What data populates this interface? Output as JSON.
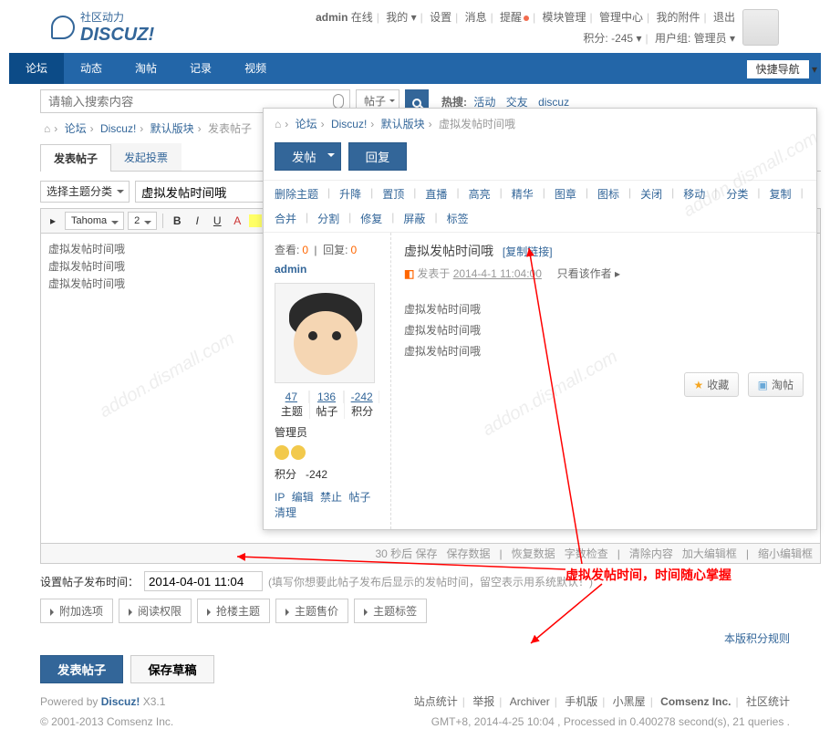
{
  "header": {
    "logo_cn": "社区动力",
    "logo_en": "DISCUZ!",
    "user": "admin",
    "status": "在线",
    "menu": [
      "我的",
      "设置",
      "消息",
      "提醒",
      "模块管理",
      "管理中心",
      "我的附件",
      "退出"
    ],
    "credits_label": "积分:",
    "credits": "-245",
    "group_label": "用户组:",
    "group": "管理员"
  },
  "nav": {
    "items": [
      "论坛",
      "动态",
      "淘帖",
      "记录",
      "视频"
    ],
    "quick": "快捷导航"
  },
  "search": {
    "placeholder": "请输入搜索内容",
    "scope": "帖子",
    "hot_label": "热搜:",
    "hot": [
      "活动",
      "交友",
      "discuz"
    ]
  },
  "bc": [
    "论坛",
    "Discuz!",
    "默认版块",
    "发表帖子"
  ],
  "tabs": [
    "发表帖子",
    "发起投票"
  ],
  "form": {
    "type_sel": "选择主题分类",
    "title": "虚拟发帖时间哦",
    "font": "Tahoma",
    "size": "2",
    "body": [
      "虚拟发帖时间哦",
      "虚拟发帖时间哦",
      "虚拟发帖时间哦"
    ],
    "footer": [
      "30 秒后 保存",
      "保存数据",
      "恢复数据",
      "字数检查",
      "清除内容",
      "加大编辑框",
      "缩小编辑框"
    ]
  },
  "settime": {
    "label": "设置帖子发布时间：",
    "value": "2014-04-01 11:04",
    "hint": "(填写你想要此帖子发布后显示的发帖时间，留空表示用系统默认！)"
  },
  "opts": [
    "附加选项",
    "阅读权限",
    "抢楼主题",
    "主题售价",
    "主题标签"
  ],
  "submit": {
    "post": "发表帖子",
    "draft": "保存草稿"
  },
  "rules": "本版积分规则",
  "popup": {
    "bc": [
      "论坛",
      "Discuz!",
      "默认版块",
      "虚拟发帖时间哦"
    ],
    "post": "发帖",
    "reply": "回复",
    "mod": [
      "删除主题",
      "升降",
      "置顶",
      "直播",
      "高亮",
      "精华",
      "图章",
      "图标",
      "关闭",
      "移动",
      "分类",
      "复制",
      "合并",
      "分割",
      "修复",
      "屏蔽",
      "标签"
    ],
    "views_l": "查看:",
    "views": "0",
    "replies_l": "回复:",
    "replies": "0",
    "user": "admin",
    "stats": [
      {
        "n": "47",
        "l": "主题"
      },
      {
        "n": "136",
        "l": "帖子"
      },
      {
        "n": "-242",
        "l": "积分"
      }
    ],
    "group": "管理员",
    "credits_l": "积分",
    "credits": "-242",
    "links": [
      "IP",
      "编辑",
      "禁止",
      "帖子",
      "清理"
    ],
    "title": "虚拟发帖时间哦",
    "copy": "[复制链接]",
    "posted_l": "发表于",
    "posted": "2014-4-1 11:04:00",
    "only": "只看该作者",
    "body": [
      "虚拟发帖时间哦",
      "虚拟发帖时间哦",
      "虚拟发帖时间哦"
    ],
    "fav": "收藏",
    "scoop": "淘帖"
  },
  "anno": "虚拟发帖时间，时间随心掌握",
  "foot": {
    "pow": "Powered by ",
    "dz": "Discuz!",
    "ver": " X3.1",
    "cpy": "© 2001-2013 Comsenz Inc.",
    "links": [
      "站点统计",
      "举报",
      "Archiver",
      "手机版",
      "小黑屋",
      "Comsenz Inc.",
      "社区统计"
    ],
    "stamp": "GMT+8, 2014-4-25 10:04 , Processed in 0.400278 second(s), 21 queries ."
  }
}
